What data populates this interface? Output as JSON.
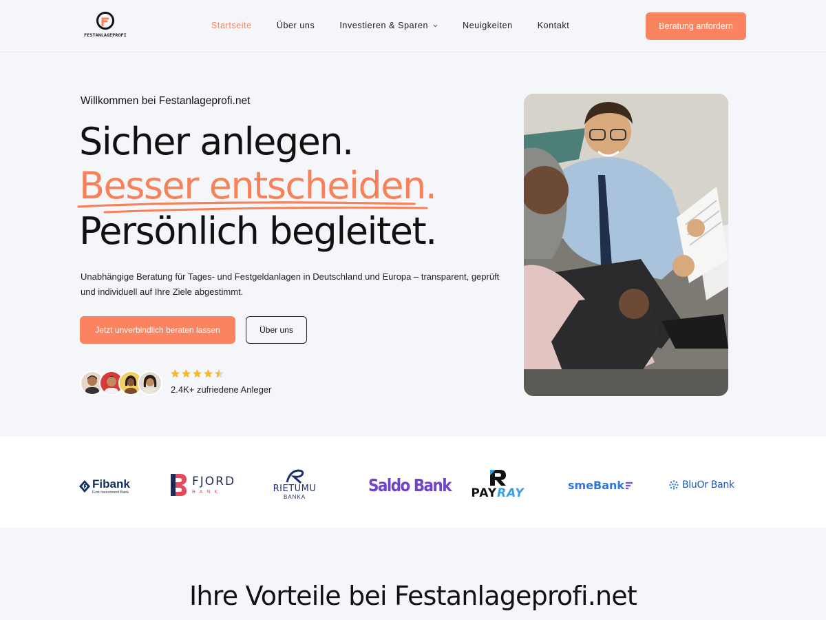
{
  "header": {
    "logo_text": "FESTANLAGEPROFI",
    "nav": [
      {
        "label": "Startseite",
        "active": true
      },
      {
        "label": "Über uns",
        "active": false
      },
      {
        "label": "Investieren & Sparen",
        "active": false,
        "has_dropdown": true
      },
      {
        "label": "Neuigkeiten",
        "active": false
      },
      {
        "label": "Kontakt",
        "active": false
      }
    ],
    "cta_label": "Beratung anfordern"
  },
  "hero": {
    "welcome": "Willkommen bei Festanlageprofi.net",
    "headline_1": "Sicher anlegen.",
    "headline_2": "Besser entscheiden.",
    "headline_3": "Persönlich begleitet.",
    "lead": "Unabhängige Beratung für Tages- und Festgeldanlagen in Deutschland und Europa – transparent, geprüft und individuell auf Ihre Ziele abgestimmt.",
    "primary_button": "Jetzt unverbindlich beraten lassen",
    "secondary_button": "Über uns",
    "rating_stars": 4.5,
    "rating_max": 5,
    "happy_customers": "2.4K+ zufriedene Anleger"
  },
  "banks": {
    "fibank_name": "Fibank",
    "fibank_sub": "First Investment Bank",
    "fjord_name": "FJORD",
    "fjord_sub": "BANK",
    "rietumu_name": "RIETUMU",
    "rietumu_sub": "BANKA",
    "saldo_name": "Saldo Bank",
    "payray_a": "PAY",
    "payray_b": "RAY",
    "sme_name": "smeBank",
    "bluor_name": "BluOr Bank"
  },
  "section": {
    "title": "Ihre Vorteile bei Festanlageprofi.net"
  },
  "colors": {
    "accent": "#fa8460",
    "background": "#f5f6fa",
    "text": "#111111"
  }
}
